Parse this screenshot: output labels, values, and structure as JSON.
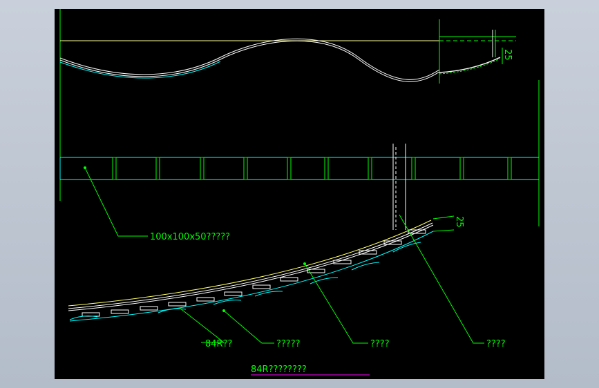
{
  "drawing": {
    "title": "84R????????",
    "dimension_top": "25",
    "dimension_bottom": "25"
  },
  "callouts": [
    {
      "id": "block",
      "text": "100x100x50?????"
    },
    {
      "id": "r84",
      "text": "84R??"
    },
    {
      "id": "c2",
      "text": "?????"
    },
    {
      "id": "c3",
      "text": "????"
    },
    {
      "id": "c4",
      "text": "????"
    }
  ],
  "colors": {
    "background": "#000000",
    "frame": "#c0c8d4",
    "line_green": "#00ff00",
    "line_cyan": "#00ffff",
    "line_white": "#ffffff",
    "line_yellow": "#ffff66",
    "title_underline": "#ff00ff"
  }
}
